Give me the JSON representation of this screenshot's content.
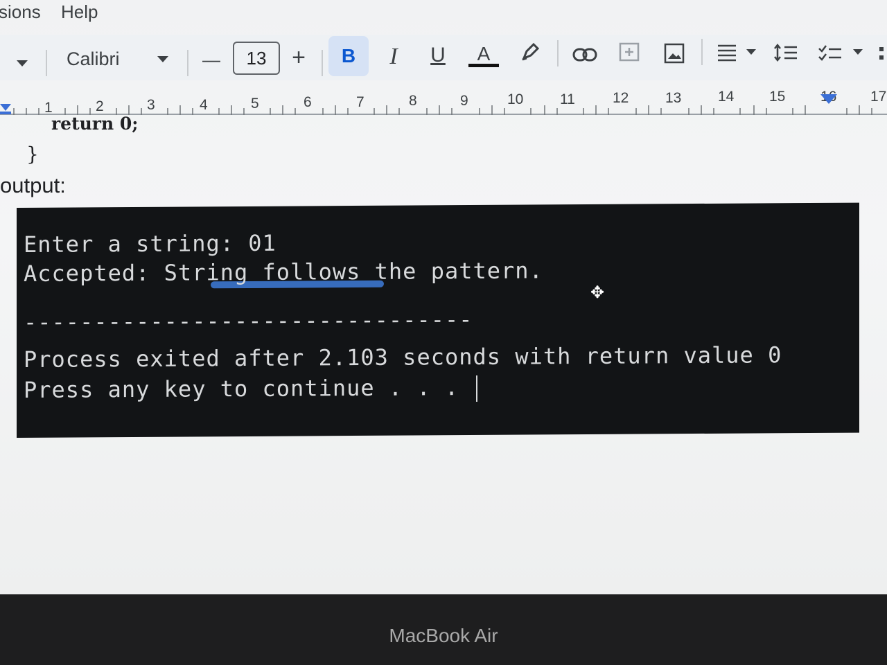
{
  "menu": {
    "partial_item": "sions",
    "help": "Help"
  },
  "toolbar": {
    "font_name": "Calibri",
    "font_size": "13",
    "decrease": "—",
    "increase": "+",
    "bold": "B",
    "italic": "I",
    "underline": "U",
    "text_color": "A"
  },
  "ruler": {
    "labels": [
      "1",
      "2",
      "3",
      "4",
      "5",
      "6",
      "7",
      "8",
      "9",
      "10",
      "11",
      "12",
      "13",
      "14",
      "15",
      "16",
      "17"
    ]
  },
  "document": {
    "code_return": "return 0;",
    "code_brace": "}",
    "output_label": "output:"
  },
  "console": {
    "line1": "Enter a string: 01",
    "line2": "Accepted: String follows the pattern.",
    "separator": "--------------------------------",
    "line3": "Process exited after 2.103 seconds with return value 0",
    "line4": "Press any key to continue . . . "
  },
  "device": {
    "label": "MacBook Air"
  },
  "colors": {
    "accent": "#0b57d0",
    "console_bg": "#121416",
    "console_text": "#d8dadc"
  }
}
